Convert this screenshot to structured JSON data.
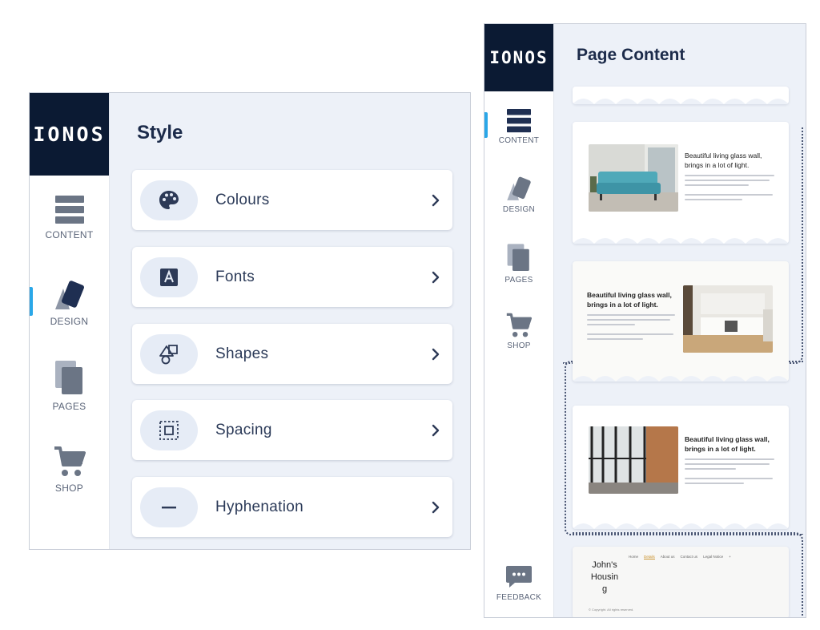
{
  "style_panel": {
    "logo": "IONOS",
    "title": "Style",
    "nav": [
      {
        "label": "CONTENT",
        "icon": "content-icon",
        "active": false
      },
      {
        "label": "DESIGN",
        "icon": "design-icon",
        "active": true
      },
      {
        "label": "PAGES",
        "icon": "pages-icon",
        "active": false
      },
      {
        "label": "SHOP",
        "icon": "shop-icon",
        "active": false
      }
    ],
    "rows": [
      {
        "label": "Colours",
        "icon": "palette-icon"
      },
      {
        "label": "Fonts",
        "icon": "font-icon"
      },
      {
        "label": "Shapes",
        "icon": "shapes-icon"
      },
      {
        "label": "Spacing",
        "icon": "spacing-icon"
      },
      {
        "label": "Hyphenation",
        "icon": "hyphenation-icon"
      }
    ]
  },
  "content_panel": {
    "logo": "IONOS",
    "title": "Page Content",
    "nav": [
      {
        "label": "CONTENT",
        "icon": "content-icon",
        "active": true
      },
      {
        "label": "DESIGN",
        "icon": "design-icon",
        "active": false
      },
      {
        "label": "PAGES",
        "icon": "pages-icon",
        "active": false
      },
      {
        "label": "SHOP",
        "icon": "shop-icon",
        "active": false
      }
    ],
    "feedback_label": "FEEDBACK",
    "sections": [
      {
        "heading": "Beautiful living glass wall, brings in a lot of light.",
        "image": "sofa-room-image"
      },
      {
        "heading": "Beautiful living glass wall, brings in a lot of light.",
        "image": "kitchen-image"
      },
      {
        "heading": "Beautiful living glass wall, brings in a lot of light.",
        "image": "glass-wall-image"
      }
    ],
    "footer": {
      "site_name": "John's Housing",
      "nav_links": [
        "Home",
        "Details",
        "About us",
        "Contact us",
        "Legal Notice",
        "+"
      ],
      "copyright": "© Copyright. All rights reserved."
    }
  },
  "colors": {
    "navy": "#0b1a33",
    "accent": "#2aa7e8",
    "panel_bg": "#edf1f8",
    "icon": "#3d4a66"
  }
}
